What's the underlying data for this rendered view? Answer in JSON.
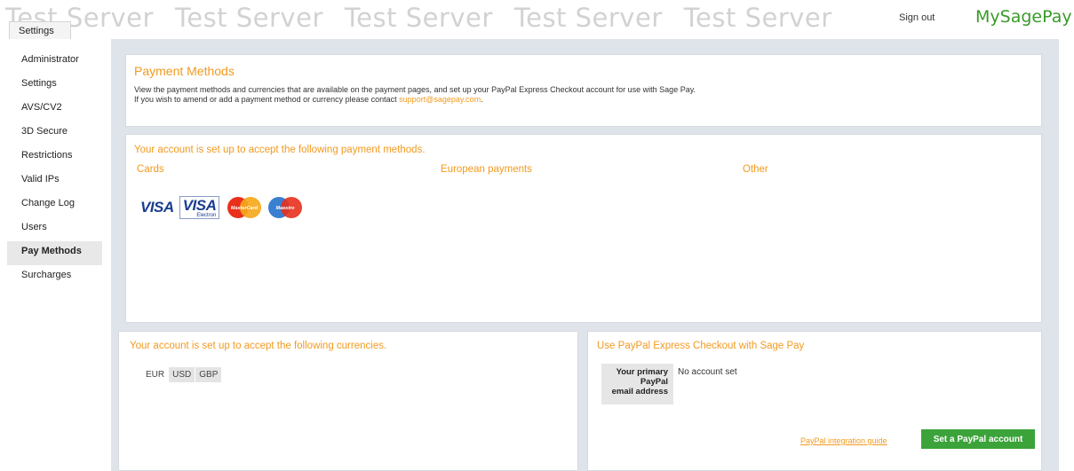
{
  "watermark": [
    "Test Server",
    "Test Server",
    "Test Server",
    "Test Server",
    "Test Server"
  ],
  "tab": {
    "label": "Settings"
  },
  "header": {
    "signout_label": "Sign out",
    "logo_text": "MySagePay"
  },
  "sidebar": {
    "items": [
      {
        "label": "Administrator"
      },
      {
        "label": "Settings"
      },
      {
        "label": "AVS/CV2"
      },
      {
        "label": "3D Secure"
      },
      {
        "label": "Restrictions"
      },
      {
        "label": "Valid IPs"
      },
      {
        "label": "Change Log"
      },
      {
        "label": "Users"
      },
      {
        "label": "Pay Methods",
        "active": true
      },
      {
        "label": "Surcharges"
      }
    ]
  },
  "payment_methods": {
    "title": "Payment Methods",
    "desc_line1": "View the payment methods and currencies that are available on the payment pages, and set up your PayPal Express Checkout account for use with Sage Pay.",
    "desc_line2_prefix": "If you wish to amend or add a payment method or currency please contact ",
    "support_email": "support@sagepay.com",
    "desc_line2_suffix": "."
  },
  "methods": {
    "title": "Your account is set up to accept the following payment methods.",
    "col_cards": "Cards",
    "col_european": "European payments",
    "col_other": "Other",
    "card_logos": [
      "VISA",
      "VISA",
      "MasterCard",
      "Maestro"
    ],
    "visa_electron_sub": "Electron"
  },
  "currencies": {
    "title": "Your account is set up to accept the following currencies.",
    "items": [
      {
        "code": "EUR",
        "selected": false
      },
      {
        "code": "USD",
        "selected": true
      },
      {
        "code": "GBP",
        "selected": true
      }
    ]
  },
  "paypal": {
    "title": "Use PayPal Express Checkout with Sage Pay",
    "label_line1": "Your primary",
    "label_line2": "PayPal",
    "label_line3": "email address",
    "value": "No account set",
    "guide_label": "PayPal integration guide",
    "button_label": "Set a PayPal account"
  },
  "colors": {
    "accent": "#f29a1f",
    "brand_green": "#3a9a2a",
    "button_green": "#3ba33a",
    "background": "#dfe3ea"
  }
}
